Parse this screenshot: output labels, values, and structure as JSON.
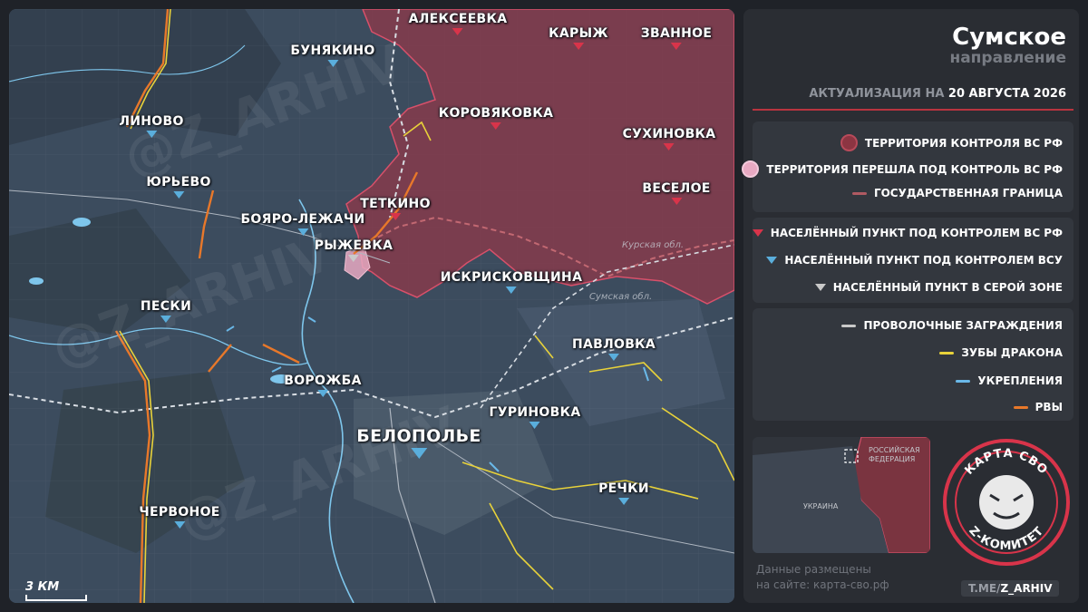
{
  "map": {
    "watermark": "@Z_ARHIV",
    "scale_label": "3 КМ",
    "oblast_labels": [
      "Курская обл.",
      "Сумская обл."
    ],
    "towns": [
      {
        "key": "alekseevka",
        "name": "АЛЕКСЕЕВКА",
        "control": "ru"
      },
      {
        "key": "karyzh",
        "name": "КАРЫЖ",
        "control": "ru"
      },
      {
        "key": "zvannoe",
        "name": "ЗВАННОЕ",
        "control": "ru"
      },
      {
        "key": "bunyakino",
        "name": "БУНЯКИНО",
        "control": "ua"
      },
      {
        "key": "linovo",
        "name": "ЛИНОВО",
        "control": "ua"
      },
      {
        "key": "korovyakovka",
        "name": "КОРОВЯКОВКА",
        "control": "ru"
      },
      {
        "key": "sukhinovka",
        "name": "СУХИНОВКА",
        "control": "ru"
      },
      {
        "key": "yurevo",
        "name": "ЮРЬЕВО",
        "control": "ua"
      },
      {
        "key": "veseloe",
        "name": "ВЕСЕЛОЕ",
        "control": "ru"
      },
      {
        "key": "tetkino",
        "name": "ТЕТКИНО",
        "control": "ru"
      },
      {
        "key": "boyaro",
        "name": "БОЯРО-ЛЕЖАЧИ",
        "control": "ua"
      },
      {
        "key": "ryzhevka",
        "name": "РЫЖЕВКА",
        "control": "grey"
      },
      {
        "key": "iskriskovshchina",
        "name": "ИСКРИСКОВЩИНА",
        "control": "ua"
      },
      {
        "key": "peski",
        "name": "ПЕСКИ",
        "control": "ua"
      },
      {
        "key": "pavlovka",
        "name": "ПАВЛОВКА",
        "control": "ua"
      },
      {
        "key": "vorozhba",
        "name": "ВОРОЖБА",
        "control": "ua"
      },
      {
        "key": "gurinovka",
        "name": "ГУРИНОВКА",
        "control": "ua"
      },
      {
        "key": "belopolye",
        "name": "БЕЛОПОЛЬЕ",
        "control": "ua"
      },
      {
        "key": "rechki",
        "name": "РЕЧКИ",
        "control": "ua"
      },
      {
        "key": "chervonoe",
        "name": "ЧЕРВОНОЕ",
        "control": "ua"
      }
    ]
  },
  "panel": {
    "title": "Сумское",
    "subtitle": "направление",
    "update_prefix": "АКТУАЛИЗАЦИЯ НА",
    "update_date": "20 АВГУСТА 2026",
    "legend_territory": [
      {
        "label": "ТЕРРИТОРИЯ КОНТРОЛЯ ВС РФ",
        "color": "#8c3542"
      },
      {
        "label": "ТЕРРИТОРИЯ ПЕРЕШЛА ПОД КОНТРОЛЬ ВС РФ",
        "color": "#e8a9c2"
      },
      {
        "label": "ГОСУДАРСТВЕННАЯ ГРАНИЦА",
        "color": "#b05a62"
      }
    ],
    "legend_settlements": [
      {
        "label": "НАСЕЛЁННЫЙ ПУНКТ ПОД КОНТРОЛЕМ ВС РФ",
        "color": "#d8344a"
      },
      {
        "label": "НАСЕЛЁННЫЙ ПУНКТ ПОД КОНТРОЛЕМ ВСУ",
        "color": "#5aaedc"
      },
      {
        "label": "НАСЕЛЁННЫЙ ПУНКТ В СЕРОЙ ЗОНЕ",
        "color": "#c9c9c9"
      }
    ],
    "legend_lines": [
      {
        "label": "ПРОВОЛОЧНЫЕ ЗАГРАЖДЕНИЯ",
        "color": "#c9c9c9"
      },
      {
        "label": "ЗУБЫ ДРАКОНА",
        "color": "#e8d23a"
      },
      {
        "label": "УКРЕПЛЕНИЯ",
        "color": "#6ab8e8"
      },
      {
        "label": "РВЫ",
        "color": "#e8782a"
      }
    ],
    "minimap": {
      "russia": "РОССИЙСКАЯ ФЕДЕРАЦИЯ",
      "ukraine": "УКРАИНА"
    },
    "emblem": {
      "top": "КАРТА СВО",
      "bottom": "Z-КОМИТЕТ"
    },
    "site_line1": "Данные размещены",
    "site_line2": "на сайте: карта-сво.рф",
    "tg_prefix": "T.ME/",
    "tg_handle": "Z_ARHIV"
  }
}
